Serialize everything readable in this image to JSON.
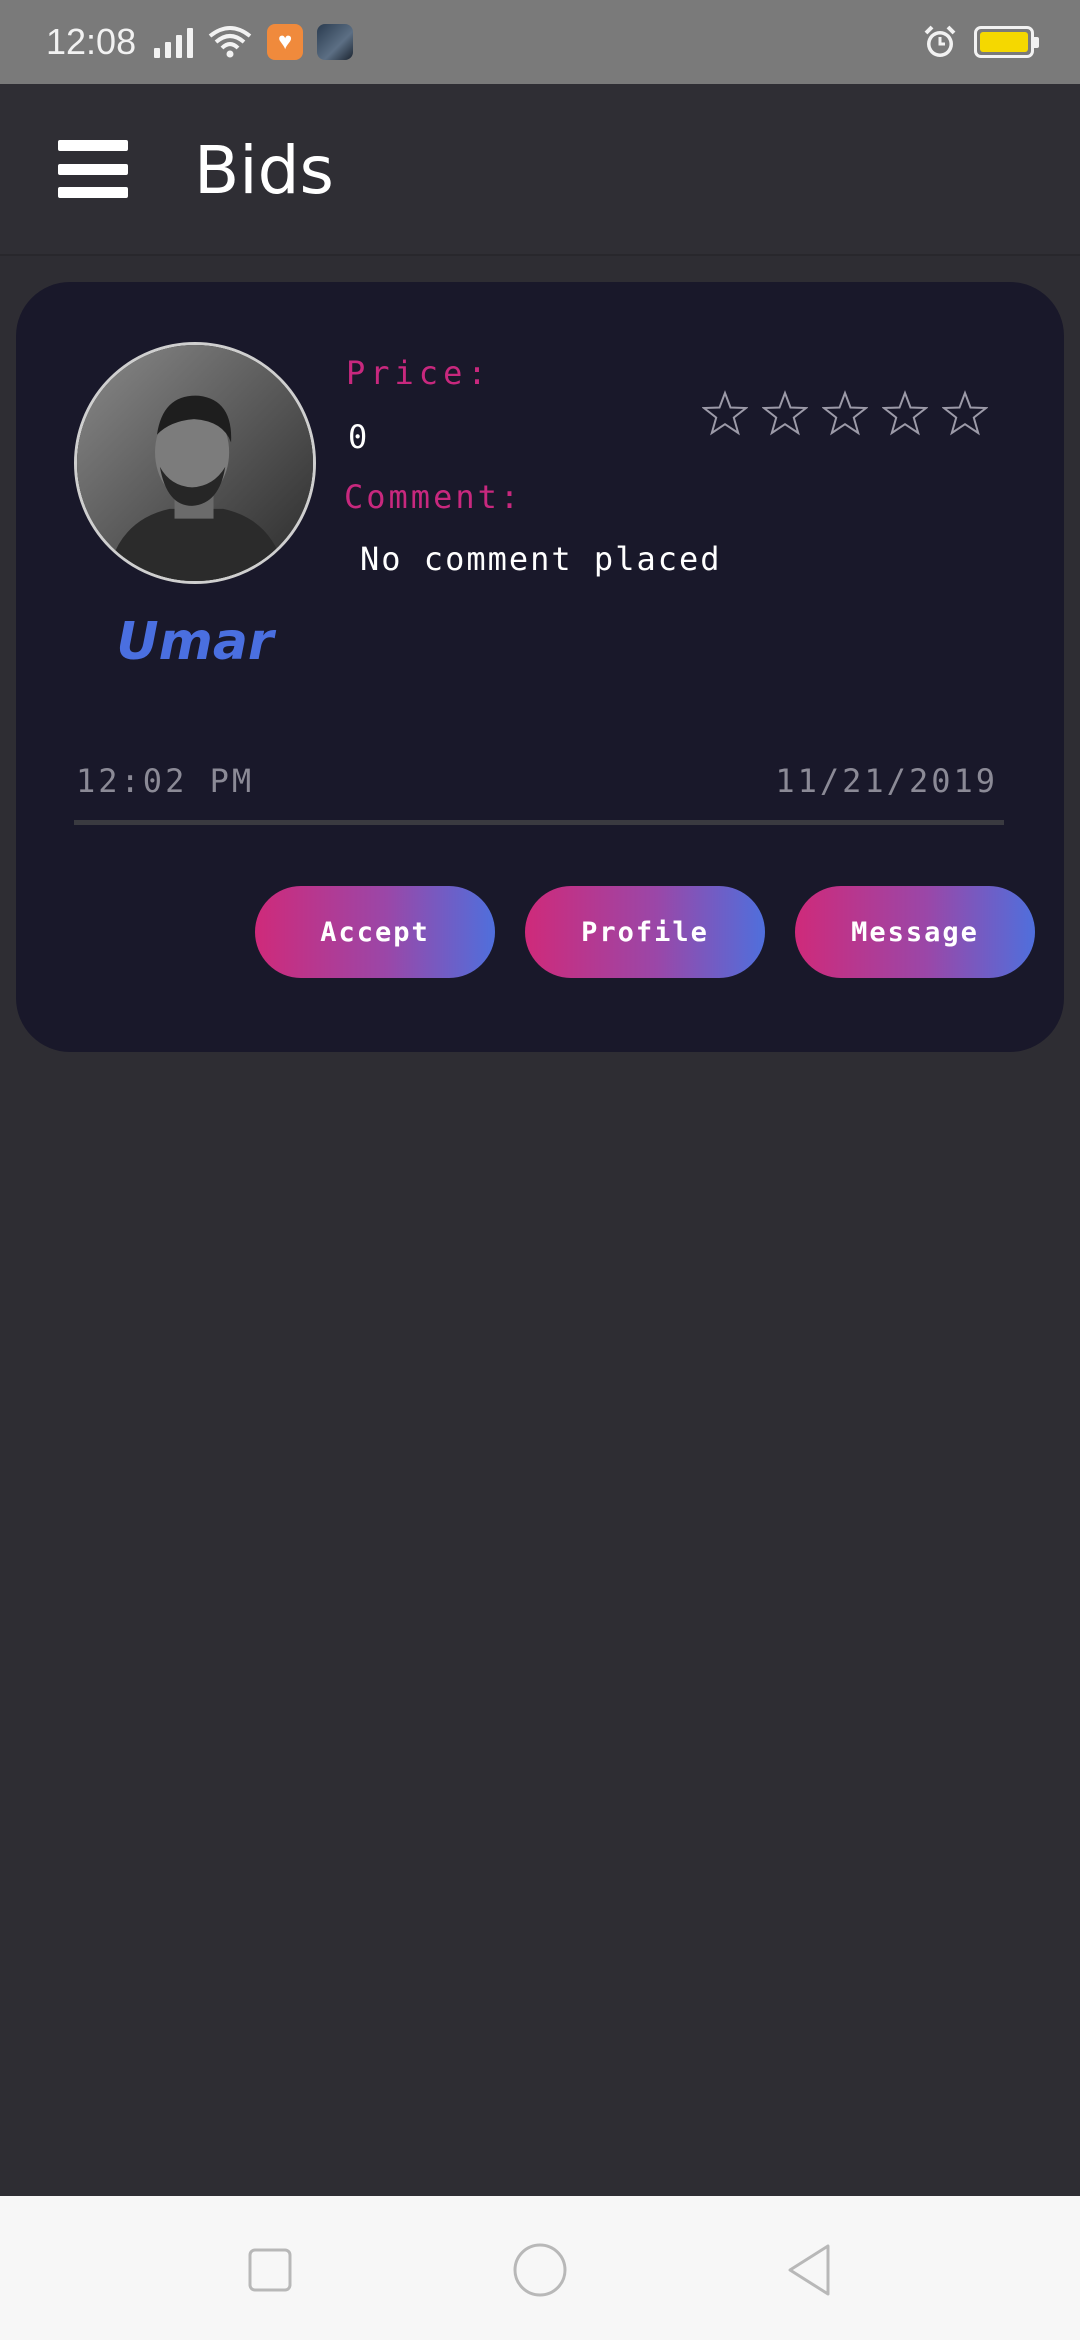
{
  "status_bar": {
    "time": "12:08",
    "signal_icon": "cellular-signal-icon",
    "wifi_icon": "wifi-icon",
    "notification_icons": [
      "health-app-icon",
      "weather-app-icon"
    ],
    "alarm_icon": "alarm-clock-icon",
    "battery_icon": "battery-icon",
    "battery_color": "#f5d800"
  },
  "app_bar": {
    "menu_icon": "hamburger-menu-icon",
    "title": "Bids"
  },
  "bid": {
    "name": "Umar",
    "price_label": "Price:",
    "price": "0",
    "comment_label": "Comment:",
    "comment": "No comment placed",
    "rating": 0,
    "rating_max": 5,
    "time": "12:02 PM",
    "date": "11/21/2019",
    "buttons": {
      "accept": "Accept",
      "profile": "Profile",
      "message": "Message"
    }
  },
  "colors": {
    "accent_pink": "#c8287e",
    "accent_blue": "#4a6fe0",
    "card_bg": "#19182a",
    "page_bg": "#2e2d33"
  },
  "nav_bar": {
    "recent_icon": "recent-apps-icon",
    "home_icon": "home-icon",
    "back_icon": "back-icon"
  }
}
